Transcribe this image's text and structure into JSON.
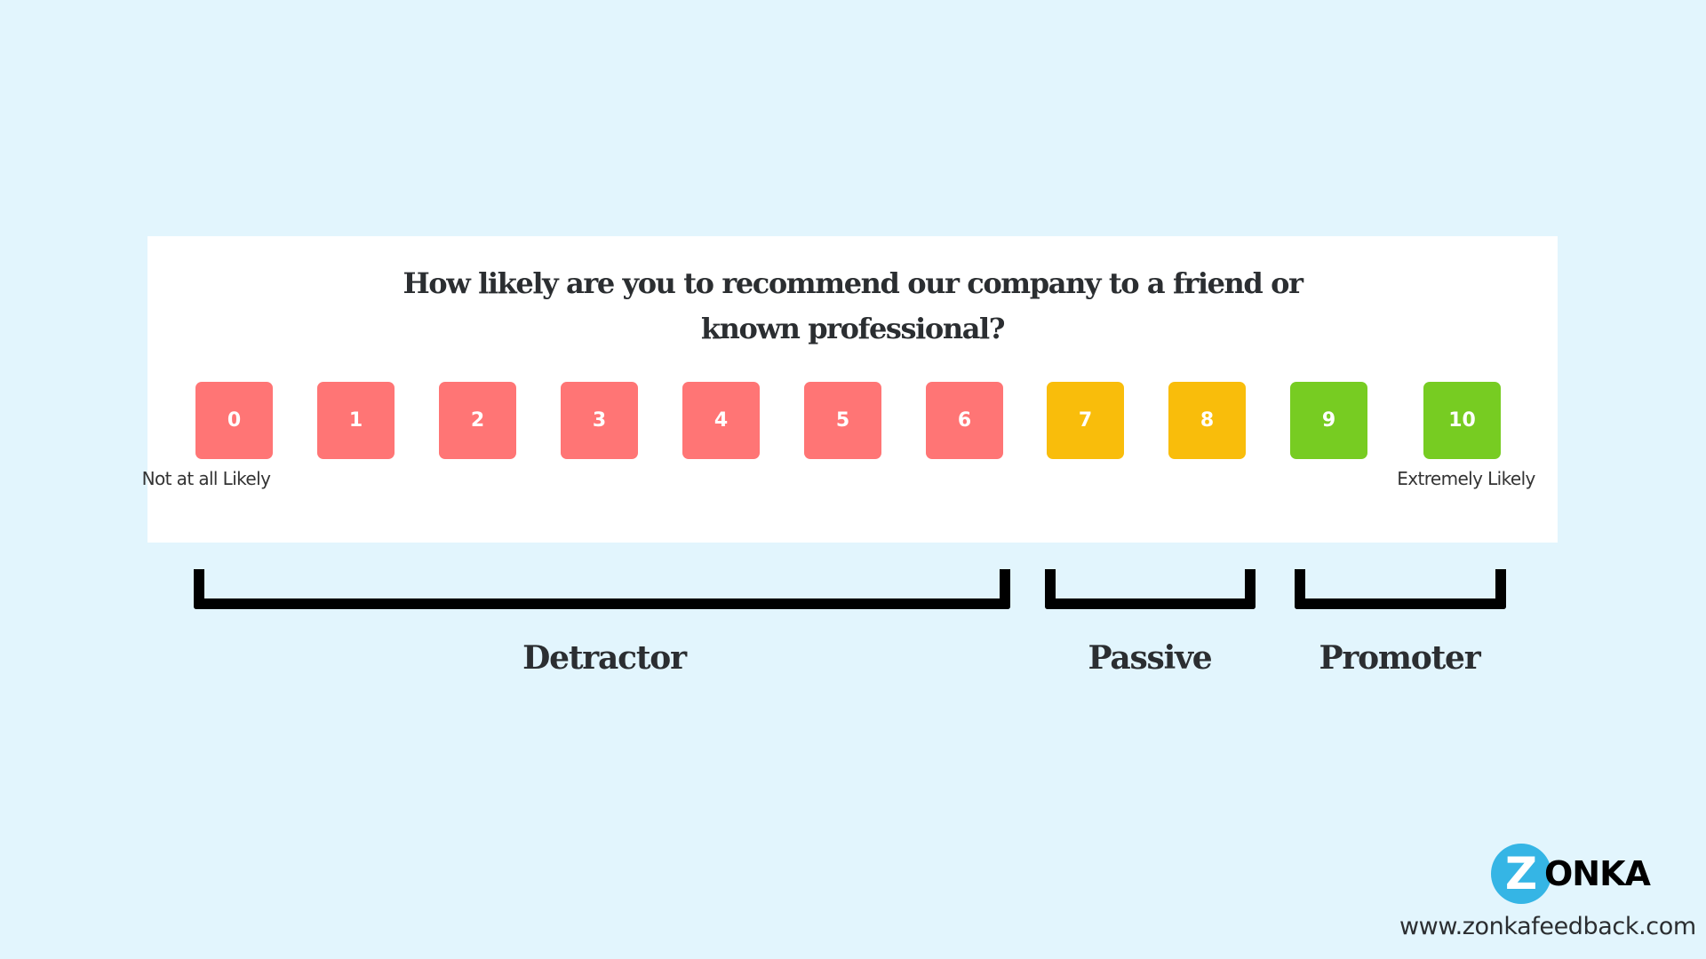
{
  "question": "How likely are you to recommend our company to a friend or known professional?",
  "scale": [
    {
      "label": "0",
      "group": "detractor"
    },
    {
      "label": "1",
      "group": "detractor"
    },
    {
      "label": "2",
      "group": "detractor"
    },
    {
      "label": "3",
      "group": "detractor"
    },
    {
      "label": "4",
      "group": "detractor"
    },
    {
      "label": "5",
      "group": "detractor"
    },
    {
      "label": "6",
      "group": "detractor"
    },
    {
      "label": "7",
      "group": "passive"
    },
    {
      "label": "8",
      "group": "passive"
    },
    {
      "label": "9",
      "group": "promoter"
    },
    {
      "label": "10",
      "group": "promoter"
    }
  ],
  "anchors": {
    "low": "Not at all Likely",
    "high": "Extremely Likely"
  },
  "groups": {
    "detractor": {
      "label": "Detractor",
      "range": "0-6",
      "color": "#FF7575"
    },
    "passive": {
      "label": "Passive",
      "range": "7-8",
      "color": "#F9BD0B"
    },
    "promoter": {
      "label": "Promoter",
      "range": "9-10",
      "color": "#77CC22"
    }
  },
  "branding": {
    "logo_initial": "Z",
    "logo_rest": "ONKA",
    "logo_color": "#35B5E5",
    "url": "www.zonkafeedback.com"
  }
}
